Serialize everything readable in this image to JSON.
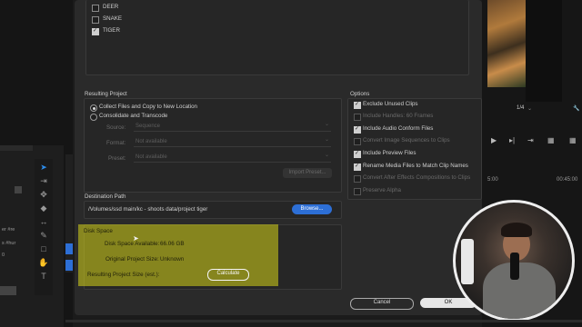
{
  "clips": [
    {
      "label": "DEER",
      "checked": false
    },
    {
      "label": "SNAKE",
      "checked": false
    },
    {
      "label": "TIGER",
      "checked": true
    }
  ],
  "resulting_project": {
    "title": "Resulting Project",
    "radio_collect": "Collect Files and Copy to New Location",
    "radio_consolidate": "Consolidate and Transcode",
    "source_label": "Source:",
    "source_value": "Sequence",
    "format_label": "Format:",
    "format_value": "Not available",
    "preset_label": "Preset:",
    "preset_value": "Not available",
    "import_preset": "Import Preset..."
  },
  "options": {
    "title": "Options",
    "items": [
      {
        "label": "Exclude Unused Clips",
        "checked": true,
        "enabled": true
      },
      {
        "label": "Include Handles:  60 Frames",
        "checked": false,
        "enabled": false
      },
      {
        "label": "Include Audio Conform Files",
        "checked": true,
        "enabled": true
      },
      {
        "label": "Convert Image Sequences to Clips",
        "checked": false,
        "enabled": false
      },
      {
        "label": "Include Preview Files",
        "checked": true,
        "enabled": true
      },
      {
        "label": "Rename Media Files to Match Clip Names",
        "checked": true,
        "enabled": true
      },
      {
        "label": "Convert After Effects Compositions to Clips",
        "checked": false,
        "enabled": false
      },
      {
        "label": "Preserve Alpha",
        "checked": false,
        "enabled": false
      }
    ]
  },
  "destination": {
    "title": "Destination Path",
    "path": "/Volumes/ssd main/kc - shoots data/project tiger",
    "browse": "Browse..."
  },
  "disk_space": {
    "title": "Disk Space",
    "available_label": "Disk Space Available:",
    "available_value": "66.06 GB",
    "original_label": "Original Project Size:",
    "original_value": "Unknown",
    "resulting_label": "Resulting Project Size (est.):",
    "calculate": "Calculate"
  },
  "footer": {
    "cancel": "Cancel",
    "ok": "OK"
  },
  "background": {
    "page_indicator": "1/4",
    "timecode_1": "5:00",
    "timecode_2": "00:45:00",
    "side_text_1": "er #re",
    "side_text_2": "s #hur",
    "zero": "0"
  },
  "colors": {
    "highlight": "#d6d418",
    "accent": "#2d6fd6"
  }
}
